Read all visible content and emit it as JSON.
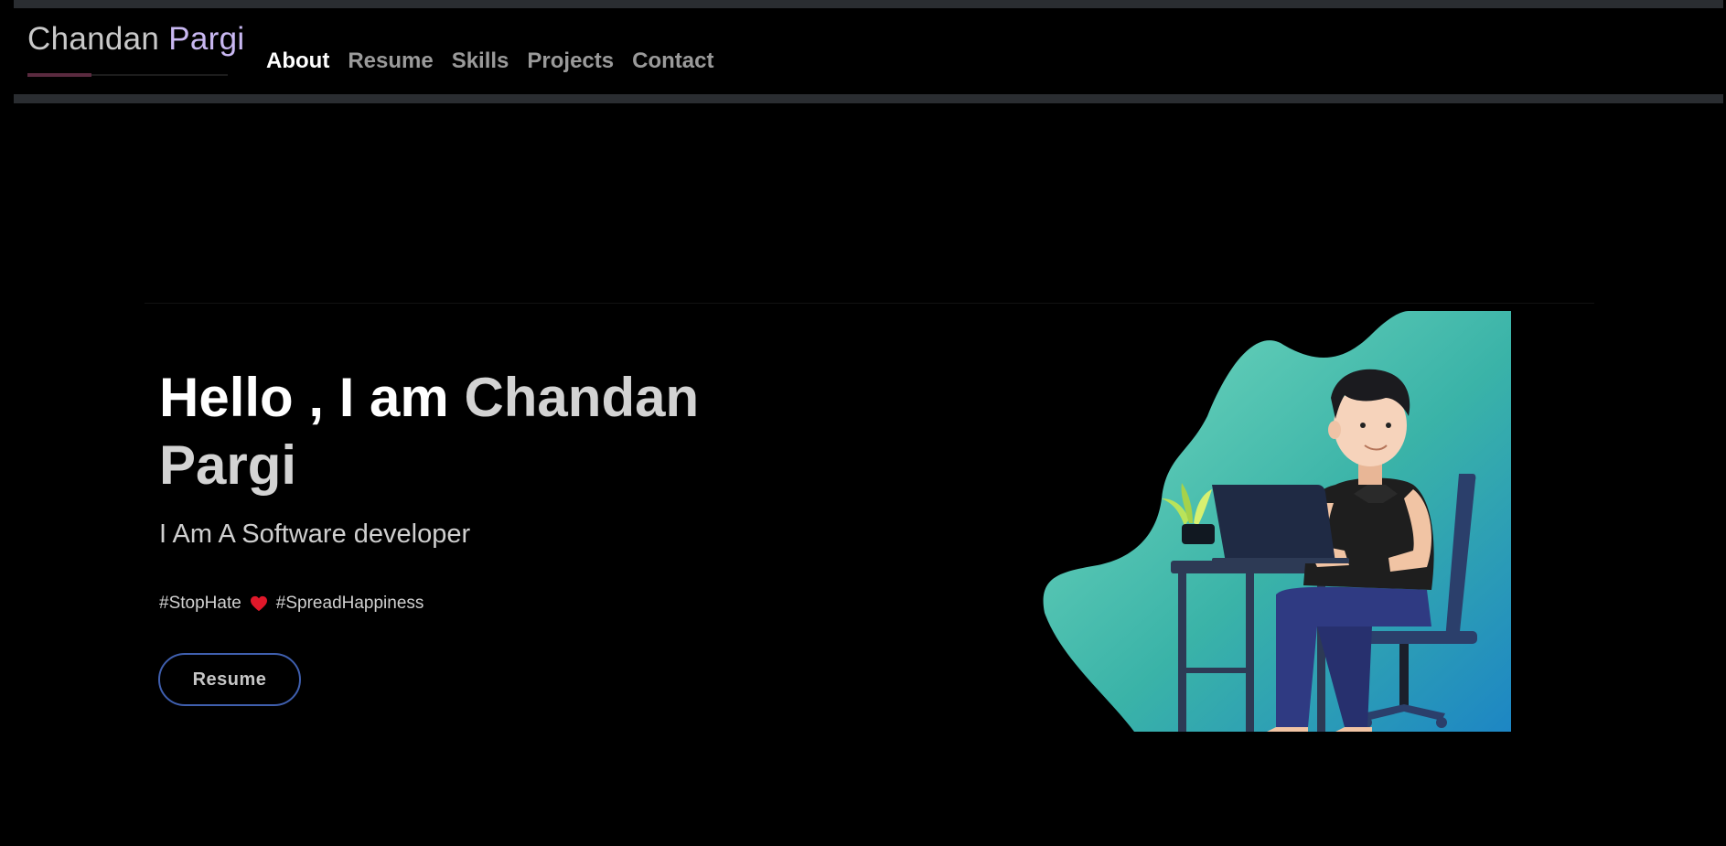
{
  "navbar": {
    "brand_first": "Chandan ",
    "brand_last": "Pargi",
    "links": [
      {
        "label": "About",
        "active": true
      },
      {
        "label": "Resume",
        "active": false
      },
      {
        "label": "Skills",
        "active": false
      },
      {
        "label": "Projects",
        "active": false
      },
      {
        "label": "Contact",
        "active": false
      }
    ]
  },
  "hero": {
    "title_prefix": "Hello , I am ",
    "title_name": "Chandan Pargi",
    "subtitle": "I Am A Software developer",
    "hashtag_1": "#StopHate",
    "hashtag_2": "#SpreadHappiness",
    "resume_button": "Resume",
    "illustration": "developer-at-laptop-illustration"
  },
  "colors": {
    "background": "#000000",
    "nav_active": "#ffffff",
    "nav_inactive": "#9a9a9a",
    "brand_accent": "#c9b8f2",
    "button_border": "#3f5fae",
    "heart": "#e0182a"
  }
}
